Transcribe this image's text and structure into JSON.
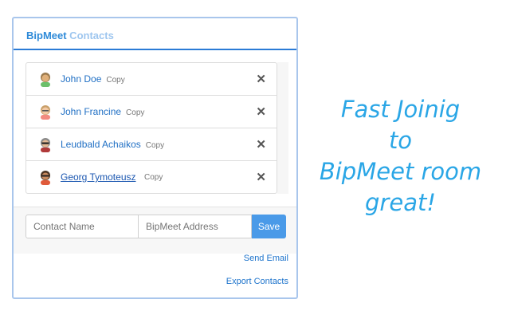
{
  "panel": {
    "title_main": "BipMeet",
    "title_fade": " Contacts"
  },
  "contacts": [
    {
      "name": "John Doe",
      "copy": "Copy",
      "underlined": false
    },
    {
      "name": "John Francine",
      "copy": "Copy",
      "underlined": false
    },
    {
      "name": "Leudbald Achaikos",
      "copy": "Copy",
      "underlined": false
    },
    {
      "name": "Georg Tymoteusz",
      "copy": "Copy",
      "underlined": true
    }
  ],
  "remove_glyph": "✕",
  "form": {
    "name_placeholder": "Contact Name",
    "address_placeholder": "BipMeet Address",
    "save_label": "Save"
  },
  "links": {
    "send_email": "Send Email",
    "export_contacts": "Export Contacts"
  },
  "slogan": [
    "Fast Joinig",
    "to",
    "BipMeet room",
    "great!"
  ],
  "colors": {
    "accent": "#2e8ad8",
    "save_button": "#4a9ae8",
    "slogan": "#2aa6e6"
  }
}
